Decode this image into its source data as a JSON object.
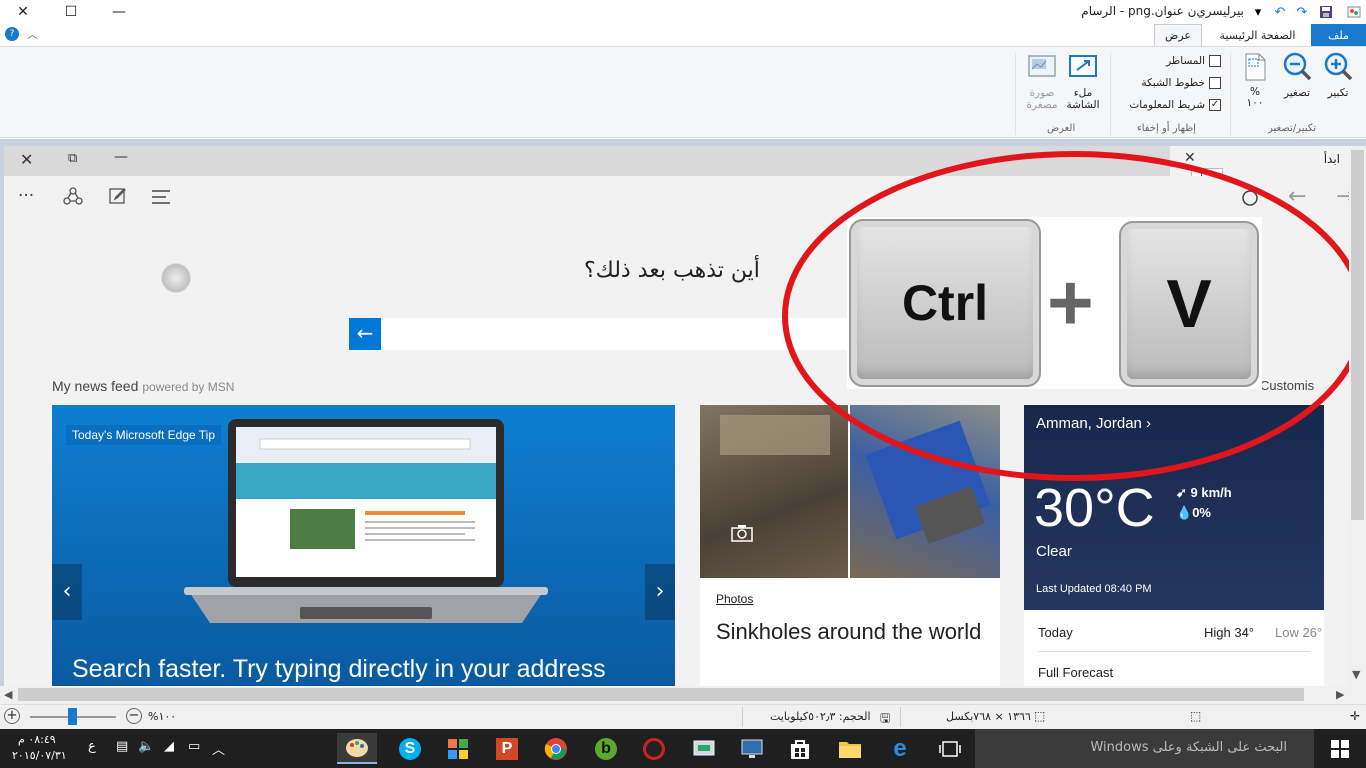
{
  "window": {
    "title": "بيرليسري‌ن عنوان.png - الرسام",
    "minimize": "—",
    "maximize": "☐",
    "close": "✕"
  },
  "ribbon": {
    "tabs": {
      "file": "ملف",
      "home": "الصفحة الرئيسية",
      "view": "عرض"
    },
    "zoom_group": {
      "zoom_in": "تكبير",
      "zoom_out": "تصغير",
      "percent": "%",
      "hundred": "١٠٠",
      "label": "تكبير/تصغير"
    },
    "show_group": {
      "rulers": "المساطر",
      "gridlines": "خطوط الشبكة",
      "statusbar": "شريط المعلومات",
      "label": "إظهار أو إخفاء"
    },
    "display_group": {
      "fullscreen_1": "ملء",
      "fullscreen_2": "الشاشة",
      "thumb_1": "صورة",
      "thumb_2": "مصغرة",
      "label": "العرض"
    }
  },
  "edge": {
    "tab_label": "ابدأ",
    "tab_label_box": "ابدأ",
    "question": "أين تذهب بعد ذلك؟",
    "newsfeed": "My news feed",
    "powered": "powered by MSN",
    "customise": "Customis",
    "tip_badge": "Today's Microsoft Edge Tip",
    "tip_headline": "Search faster. Try typing directly in your address",
    "photos_label": "Photos",
    "photos_title": "Sinkholes around the world",
    "weather": {
      "location": "Amman, Jordan",
      "temp": "30°C",
      "wind": "9 km/h",
      "precip": "0%",
      "condition": "Clear",
      "updated": "Last Updated 08:40 PM",
      "today": "Today",
      "high": "High 34°",
      "low": "Low 26°",
      "forecast": "Full Forecast"
    }
  },
  "ctrlv": {
    "ctrl": "Ctrl",
    "plus": "+",
    "v": "V"
  },
  "statusbar": {
    "zoom": "%١٠٠",
    "size": "الحجم: ٥٠٢٫٣كيلوبايت",
    "dimensions": "١٣٦٦ × ٧٦٨بكسل"
  },
  "taskbar": {
    "search": "البحث على الشبكة وعلى Windows",
    "time": "٠٨:٤٩ م",
    "date": "٢٠١٥/٠٧/٣١",
    "lang": "ع"
  },
  "colors": {
    "accent": "#1979ca",
    "edge_blue": "#0078d7",
    "ellipse": "#e0161b",
    "weather_bg": "#1d2f55"
  }
}
